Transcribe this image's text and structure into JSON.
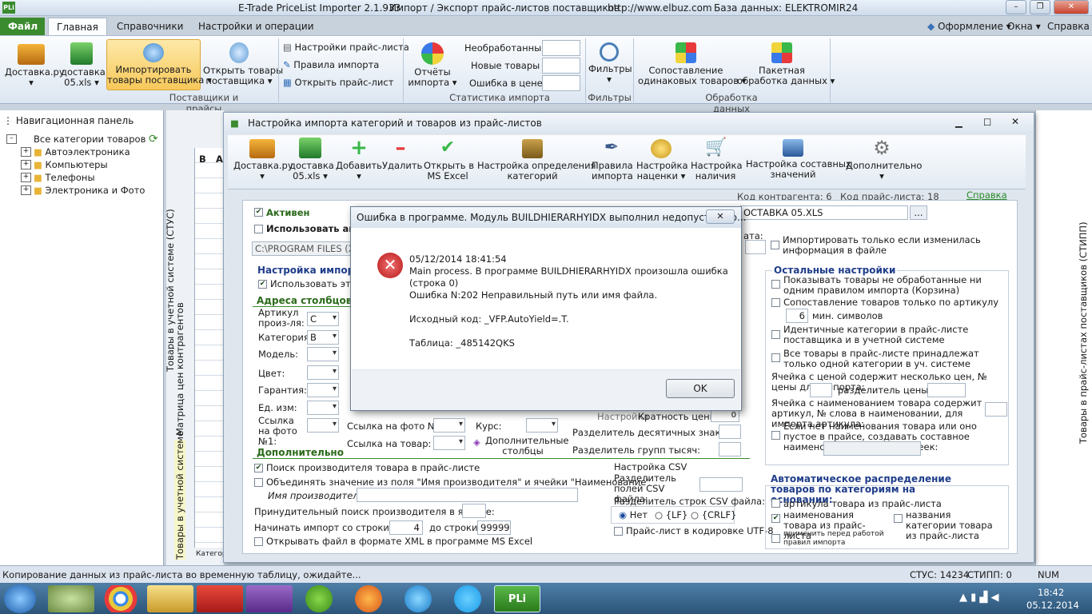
{
  "app": {
    "title": "E-Trade PriceList Importer 2.1.933",
    "subtitle": "Импорт / Экспорт прайс-листов поставщиков",
    "url": "http://www.elbuz.com",
    "database": "База данных: ELEKTROMIR24",
    "logo": "PLi"
  },
  "tabs": [
    "Файл",
    "Главная",
    "Справочники",
    "Настройки и операции"
  ],
  "top_right": [
    "Оформление",
    "Окна",
    "Справка"
  ],
  "ribbon": {
    "b1": "Доставка.ру",
    "b2a": "доставка",
    "b2b": "05.xls",
    "b3a": "Импортировать",
    "b3b": "товары поставщика",
    "b4a": "Открыть товары",
    "b4b": "поставщика",
    "s1": "Настройки прайс-листа",
    "s2": "Правила импорта",
    "s3": "Открыть прайс-лист",
    "b5a": "Отчёты",
    "b5b": "импорта",
    "st1": "Необработанные",
    "st2": "Новые товары",
    "st3": "Ошибка в цене",
    "b6": "Фильтры",
    "b7a": "Сопоставление",
    "b7b": "одинаковых товаров",
    "b8a": "Пакетная",
    "b8b": "обработка данных",
    "g1": "Поставщики и прайсы",
    "g2": "Статистика импорта",
    "g3": "Фильтры",
    "g4": "Обработка данных"
  },
  "nav": {
    "title": "Навигационная панель",
    "root": "Все категории товаров",
    "items": [
      "Автоэлектроника",
      "Компьютеры",
      "Телефоны",
      "Электроника и Фото"
    ]
  },
  "side_labels": {
    "left1": "Товары в учетной системе (СТУС)",
    "left2": "Матрица цен контрагентов",
    "left3": "Товары в учетной системе",
    "right": "Товары в прайс-листах поставщиков (СТИПП)",
    "grid_b": "В",
    "grid_a": "А",
    "grid_cat": "Категор"
  },
  "dialog": {
    "title": "Настройка импорта категорий и товаров из прайс-листов",
    "toolbar": [
      {
        "l1": "Доставка.ру",
        "l2": ""
      },
      {
        "l1": "доставка",
        "l2": "05.xls"
      },
      {
        "l1": "Добавить",
        "l2": ""
      },
      {
        "l1": "Удалить",
        "l2": ""
      },
      {
        "l1": "Открыть в",
        "l2": "MS Excel"
      },
      {
        "l1": "Настройка определения",
        "l2": "категорий"
      },
      {
        "l1": "Правила",
        "l2": "импорта"
      },
      {
        "l1": "Настройка",
        "l2": "наценки"
      },
      {
        "l1": "Настройка",
        "l2": "наличия"
      },
      {
        "l1": "Настройка составных",
        "l2": "значений"
      },
      {
        "l1": "Дополнительно",
        "l2": ""
      }
    ],
    "kod_kontragenta": "Код контрагента: 6",
    "kod_price": "Код прайс-листа: 18",
    "help_link": "Справка",
    "active": "Активен",
    "use_auto": "Использовать авт",
    "path": "C:\\PROGRAM FILES (X86",
    "price_name": "ОСТАВКА 05.XLS",
    "browse": "...",
    "rata": "ата:",
    "import_only_changed": "Импортировать только если изменилась информация в файле",
    "import_settings": "Настройка импорта",
    "use_these": "Использовать эти н",
    "columns_header": "Адреса столбцов",
    "article_label": "Артикул произ-ля:",
    "article_val": "C",
    "category_label": "Категория:",
    "category_val": "B",
    "model": "Модель:",
    "color": "Цвет:",
    "warranty": "Гарантия:",
    "unit": "Ед. изм:",
    "photo1": "Ссылка на фото №1:",
    "photo2": "Ссылка на фото №2:",
    "kurs": "Курс:",
    "goods_link": "Ссылка на товар:",
    "extra_cols": "Дополнительные столбцы",
    "nastroika": "Настройка",
    "kratnost": "Кратность цены:",
    "kratnost_val": "0",
    "dec_sep": "Разделитель десятичных знаков:",
    "group_sep": "Разделитель групп тысяч:",
    "additional_header": "Дополнительно",
    "search_producer": "Поиск производителя товара в прайс-листе",
    "merge_producer": "Объединять значение из поля \"Имя производителя\" и ячейки \"Наименование\"",
    "producer_name": "Имя производителя:",
    "force_search": "Принудительный поиск производителя в ячейке:",
    "start_row": "Начинать импорт со строки №:",
    "start_val": "4",
    "to_row": "до строки:",
    "to_val": "99999",
    "open_xml": "Открывать файл в формате XML в программе MS Excel",
    "csv_header": "Настройка CSV",
    "csv_field_sep": "Разделитель полей CSV файла:",
    "csv_row_sep": "Разделитель строк CSV файла:",
    "csv_net": "Нет",
    "csv_lf": "{LF}",
    "csv_crlf": "{CRLF}",
    "utf8": "Прайс-лист в кодировке UTF-8",
    "other_header": "Остальные настройки",
    "o1": "Показывать товары не обработанные ни одним правилом импорта (Корзина)",
    "o2": "Сопоставление товаров только по артикулу",
    "o2_val": "6",
    "o2_unit": "мин. символов",
    "o3": "Идентичные категории в прайс-листе поставщика и в учетной системе",
    "o4": "Все товары в прайс-листе принадлежат только одной категории в уч. системе",
    "o5": "Ячейка с ценой содержит несколько цен, № цены для импорта:",
    "o5b": "разделитель цены:",
    "o6": "Ячейка с наименованием товара содержит артикул, № слова в наименовании, для импорта артикула:",
    "o7": "Если нет наименования товара или оно пустое в прайсе, создавать составное наименование товара из ячеек:",
    "auto_header": "Автоматическое распределение товаров по категориям на основании:",
    "a1": "артикула товара из прайс-листа",
    "a2": "наименования товара из прайс-листа",
    "a3": "названия категории товара из прайс-листа",
    "a4": "применить перед работой правил импорта"
  },
  "error": {
    "title": "Ошибка в программе. Модуль BUILDHIERARHYIDX выполнил недопустимую...",
    "datetime": "05/12/2014 18:41:54",
    "line1": "Main process. В программе BUILDHIERARHYIDX произошла ошибка",
    "line2": "(строка 0)",
    "line3": "Ошибка N:202 Неправильный путь или имя файла.",
    "source": "Исходный код: _VFP.AutoYield=.T.",
    "table": "Таблица: _485142QKS",
    "ok": "OK"
  },
  "status": {
    "text": "Копирование данных из прайс-листа во временную таблицу, ожидайте...",
    "stus": "СТУС: 14234",
    "stipp": "СТИПП: 0",
    "num": "NUM"
  },
  "taskbar": {
    "time": "18:42",
    "date": "05.12.2014",
    "pli": "PLi"
  },
  "colors": {
    "accent_green": "#3a8b2e",
    "header_blue": "#1f3d8a",
    "error_red": "#cc2222"
  }
}
